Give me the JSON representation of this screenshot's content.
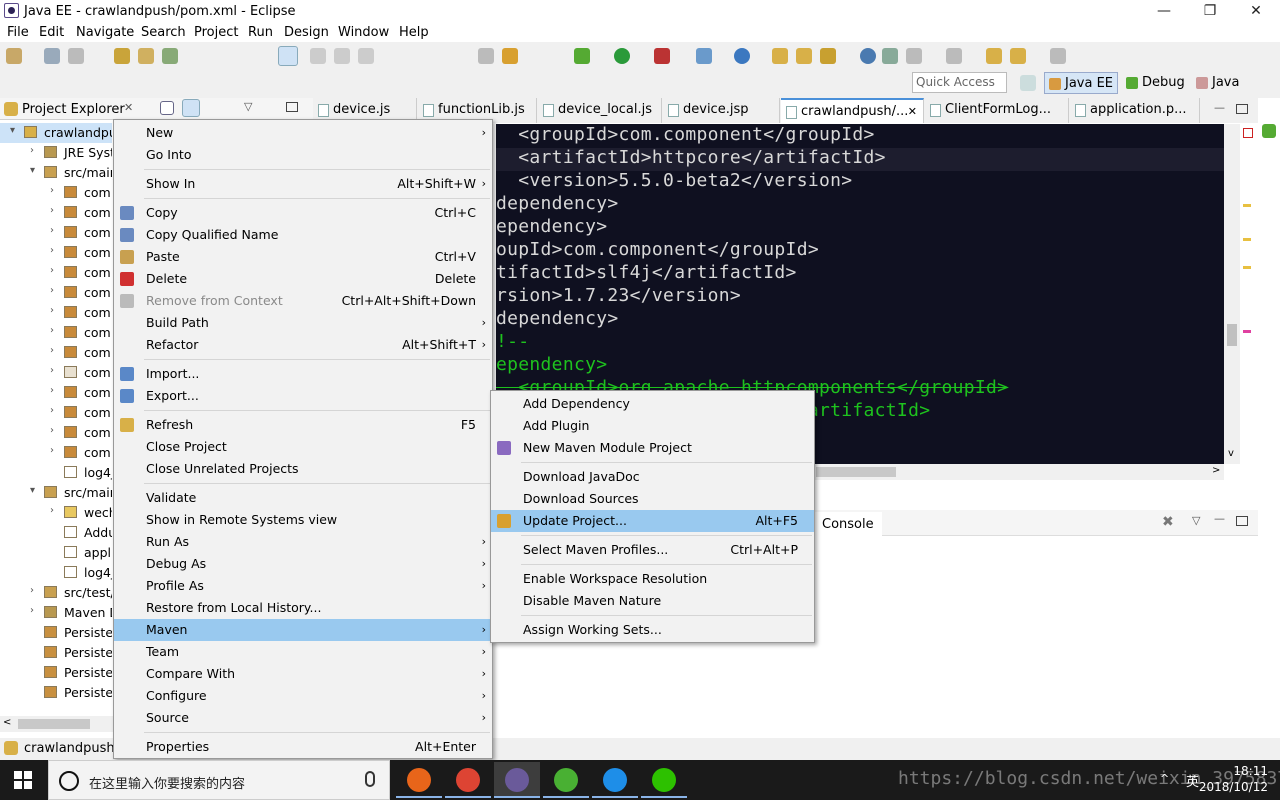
{
  "window": {
    "title": "Java EE - crawlandpush/pom.xml - Eclipse",
    "minimize": "—",
    "restore": "❐",
    "close": "✕"
  },
  "menubar": [
    "File",
    "Edit",
    "Navigate",
    "Search",
    "Project",
    "Run",
    "Design",
    "Window",
    "Help"
  ],
  "toolbar": {
    "quick_access_placeholder": "Quick Access",
    "perspectives": [
      "Java EE",
      "Debug",
      "Java"
    ]
  },
  "project_explorer": {
    "title": "Project Explorer",
    "tree": [
      {
        "label": "crawlandpu",
        "indent": 0,
        "icon": "project-icon",
        "twisty": "v",
        "selected": true
      },
      {
        "label": "JRE Syst",
        "indent": 1,
        "icon": "library-icon",
        "twisty": ">"
      },
      {
        "label": "src/mair",
        "indent": 1,
        "icon": "source-folder-icon",
        "twisty": "v"
      },
      {
        "label": "com",
        "indent": 2,
        "icon": "package-icon",
        "twisty": ">"
      },
      {
        "label": "com.",
        "indent": 2,
        "icon": "package-icon",
        "twisty": ">"
      },
      {
        "label": "com.",
        "indent": 2,
        "icon": "package-icon",
        "twisty": ">"
      },
      {
        "label": "com.",
        "indent": 2,
        "icon": "package-icon",
        "twisty": ">"
      },
      {
        "label": "com.",
        "indent": 2,
        "icon": "package-icon",
        "twisty": ">"
      },
      {
        "label": "com.",
        "indent": 2,
        "icon": "package-icon",
        "twisty": ">"
      },
      {
        "label": "com.",
        "indent": 2,
        "icon": "package-icon",
        "twisty": ">"
      },
      {
        "label": "com.",
        "indent": 2,
        "icon": "package-icon",
        "twisty": ">"
      },
      {
        "label": "com.",
        "indent": 2,
        "icon": "package-icon",
        "twisty": ">"
      },
      {
        "label": "com.",
        "indent": 2,
        "icon": "empty-package-icon",
        "twisty": ">"
      },
      {
        "label": "com.",
        "indent": 2,
        "icon": "package-icon",
        "twisty": ">"
      },
      {
        "label": "com.",
        "indent": 2,
        "icon": "package-icon",
        "twisty": ">"
      },
      {
        "label": "com.",
        "indent": 2,
        "icon": "package-icon",
        "twisty": ">"
      },
      {
        "label": "com.",
        "indent": 2,
        "icon": "package-icon",
        "twisty": ">"
      },
      {
        "label": "log4j",
        "indent": 2,
        "icon": "file-icon",
        "twisty": ""
      },
      {
        "label": "src/mair",
        "indent": 1,
        "icon": "source-folder-icon",
        "twisty": "v"
      },
      {
        "label": "wech",
        "indent": 2,
        "icon": "folder-icon",
        "twisty": ">"
      },
      {
        "label": "Addu",
        "indent": 2,
        "icon": "file-icon",
        "twisty": ""
      },
      {
        "label": "appli",
        "indent": 2,
        "icon": "file-icon",
        "twisty": ""
      },
      {
        "label": "log4j",
        "indent": 2,
        "icon": "file-icon",
        "twisty": ""
      },
      {
        "label": "src/test/",
        "indent": 1,
        "icon": "source-folder-icon",
        "twisty": ">"
      },
      {
        "label": "Maven D",
        "indent": 1,
        "icon": "library-icon",
        "twisty": ">"
      },
      {
        "label": "Persister",
        "indent": 1,
        "icon": "persistence-icon",
        "twisty": ""
      },
      {
        "label": "Persister",
        "indent": 1,
        "icon": "persistence-icon",
        "twisty": ""
      },
      {
        "label": "Persister",
        "indent": 1,
        "icon": "persistence-icon",
        "twisty": ""
      },
      {
        "label": "Persister",
        "indent": 1,
        "icon": "persistence-icon",
        "twisty": ""
      }
    ],
    "status": "crawlandpush"
  },
  "editor_tabs": [
    {
      "label": "device.js",
      "active": false
    },
    {
      "label": "functionLib.js",
      "active": false
    },
    {
      "label": "device_local.js",
      "active": false
    },
    {
      "label": "device.jsp",
      "active": false
    },
    {
      "label": "crawlandpush/...",
      "active": true,
      "close": "✕"
    },
    {
      "label": "ClientFormLog...",
      "active": false
    },
    {
      "label": "application.p...",
      "active": false
    }
  ],
  "code_lines": [
    {
      "text": "  <groupId>com.component</groupId>",
      "color": "#d8d8d8"
    },
    {
      "text": "  <artifactId>httpcore</artifactId>",
      "color": "#d8d8d8",
      "current": true
    },
    {
      "text": "  <version>5.5.0-beta2</version>",
      "color": "#d8d8d8"
    },
    {
      "text": "dependency>",
      "color": "#d8d8d8"
    },
    {
      "text": "ependency>",
      "color": "#d8d8d8"
    },
    {
      "text": "oupId>com.component</groupId>",
      "color": "#d8d8d8"
    },
    {
      "text": "tifactId>slf4j</artifactId>",
      "color": "#d8d8d8"
    },
    {
      "text": "rsion>1.7.23</version>",
      "color": "#d8d8d8"
    },
    {
      "text": "dependency>",
      "color": "#d8d8d8"
    },
    {
      "text": "!--",
      "color": "#1ec21e"
    },
    {
      "text": "ependency>",
      "color": "#1ec21e"
    },
    {
      "text": "  <groupId>org.apache.httpcomponents</groupId>",
      "color": "#1ec21e"
    },
    {
      "text": "                            artifactId>",
      "color": "#1ec21e"
    }
  ],
  "bottom": {
    "console_tab": "Console"
  },
  "context_menu": {
    "items": [
      {
        "label": "New",
        "accel": "",
        "submenu": true
      },
      {
        "label": "Go Into",
        "accel": ""
      },
      {
        "sep": true
      },
      {
        "label": "Show In",
        "accel": "Alt+Shift+W",
        "submenu": true
      },
      {
        "sep": true
      },
      {
        "label": "Copy",
        "accel": "Ctrl+C",
        "icon": "copy-icon"
      },
      {
        "label": "Copy Qualified Name",
        "accel": "",
        "icon": "copy-qualified-icon"
      },
      {
        "label": "Paste",
        "accel": "Ctrl+V",
        "icon": "paste-icon"
      },
      {
        "label": "Delete",
        "accel": "Delete",
        "icon": "delete-icon"
      },
      {
        "label": "Remove from Context",
        "accel": "Ctrl+Alt+Shift+Down",
        "disabled": true,
        "icon": "remove-context-icon"
      },
      {
        "label": "Build Path",
        "accel": "",
        "submenu": true
      },
      {
        "label": "Refactor",
        "accel": "Alt+Shift+T",
        "submenu": true
      },
      {
        "sep": true
      },
      {
        "label": "Import...",
        "accel": "",
        "icon": "import-icon"
      },
      {
        "label": "Export...",
        "accel": "",
        "icon": "export-icon"
      },
      {
        "sep": true
      },
      {
        "label": "Refresh",
        "accel": "F5",
        "icon": "refresh-icon"
      },
      {
        "label": "Close Project",
        "accel": ""
      },
      {
        "label": "Close Unrelated Projects",
        "accel": ""
      },
      {
        "sep": true
      },
      {
        "label": "Validate",
        "accel": ""
      },
      {
        "label": "Show in Remote Systems view",
        "accel": ""
      },
      {
        "label": "Run As",
        "accel": "",
        "submenu": true
      },
      {
        "label": "Debug As",
        "accel": "",
        "submenu": true
      },
      {
        "label": "Profile As",
        "accel": "",
        "submenu": true
      },
      {
        "label": "Restore from Local History...",
        "accel": ""
      },
      {
        "label": "Maven",
        "accel": "",
        "submenu": true,
        "highlight": true
      },
      {
        "label": "Team",
        "accel": "",
        "submenu": true
      },
      {
        "label": "Compare With",
        "accel": "",
        "submenu": true
      },
      {
        "label": "Configure",
        "accel": "",
        "submenu": true
      },
      {
        "label": "Source",
        "accel": "",
        "submenu": true
      },
      {
        "sep": true
      },
      {
        "label": "Properties",
        "accel": "Alt+Enter"
      }
    ]
  },
  "maven_submenu": {
    "items": [
      {
        "label": "Add Dependency",
        "accel": ""
      },
      {
        "label": "Add Plugin",
        "accel": ""
      },
      {
        "label": "New Maven Module Project",
        "accel": "",
        "icon": "maven-module-icon"
      },
      {
        "sep": true
      },
      {
        "label": "Download JavaDoc",
        "accel": ""
      },
      {
        "label": "Download Sources",
        "accel": ""
      },
      {
        "label": "Update Project...",
        "accel": "Alt+F5",
        "highlight": true,
        "icon": "update-project-icon"
      },
      {
        "sep": true
      },
      {
        "label": "Select Maven Profiles...",
        "accel": "Ctrl+Alt+P"
      },
      {
        "sep": true
      },
      {
        "label": "Enable Workspace Resolution",
        "accel": ""
      },
      {
        "label": "Disable Maven Nature",
        "accel": ""
      },
      {
        "sep": true
      },
      {
        "label": "Assign Working Sets...",
        "accel": ""
      }
    ]
  },
  "taskbar": {
    "search_placeholder": "在这里输入你要搜索的内容",
    "apps": [
      {
        "name": "firefox-icon",
        "color": "#e8651a"
      },
      {
        "name": "chrome-icon",
        "color": "#dd4433"
      },
      {
        "name": "eclipse-icon",
        "color": "#6a5a9a",
        "active": true
      },
      {
        "name": "app-green-icon",
        "color": "#49b033"
      },
      {
        "name": "app-blue-icon",
        "color": "#1e8ee8"
      },
      {
        "name": "wechat-icon",
        "color": "#2dc100"
      }
    ],
    "time": "18:11",
    "date": "2018/10/12",
    "ime": "英"
  },
  "watermark": "https://blog.csdn.net/weixin_39758376"
}
